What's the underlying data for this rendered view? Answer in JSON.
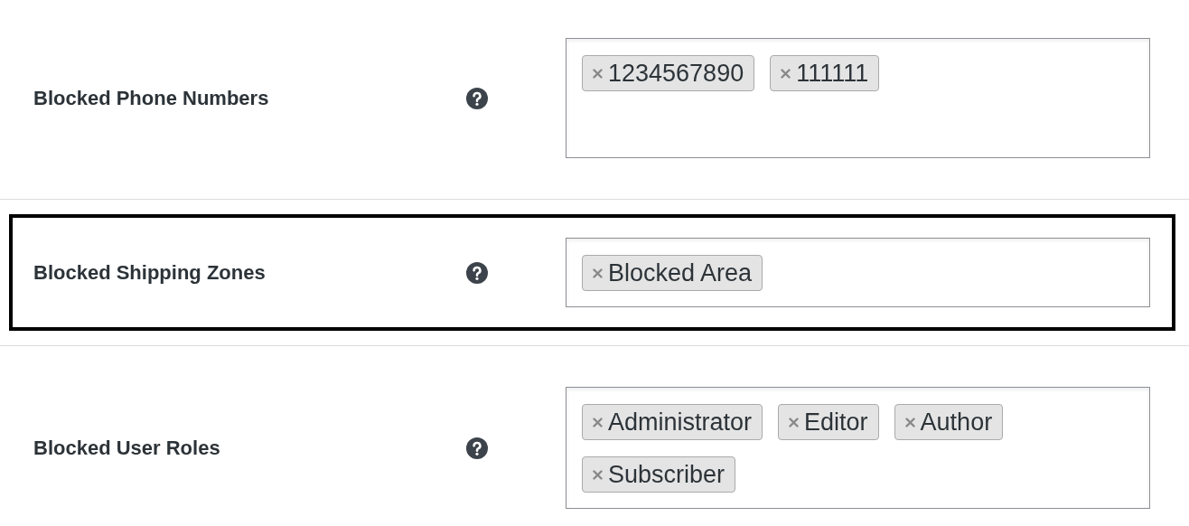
{
  "rows": [
    {
      "label": "Blocked Phone Numbers",
      "highlighted": false,
      "tags": [
        "1234567890",
        "111111"
      ]
    },
    {
      "label": "Blocked Shipping Zones",
      "highlighted": true,
      "tags": [
        "Blocked Area"
      ]
    },
    {
      "label": "Blocked User Roles",
      "highlighted": false,
      "tags": [
        "Administrator",
        "Editor",
        "Author",
        "Subscriber"
      ]
    }
  ]
}
